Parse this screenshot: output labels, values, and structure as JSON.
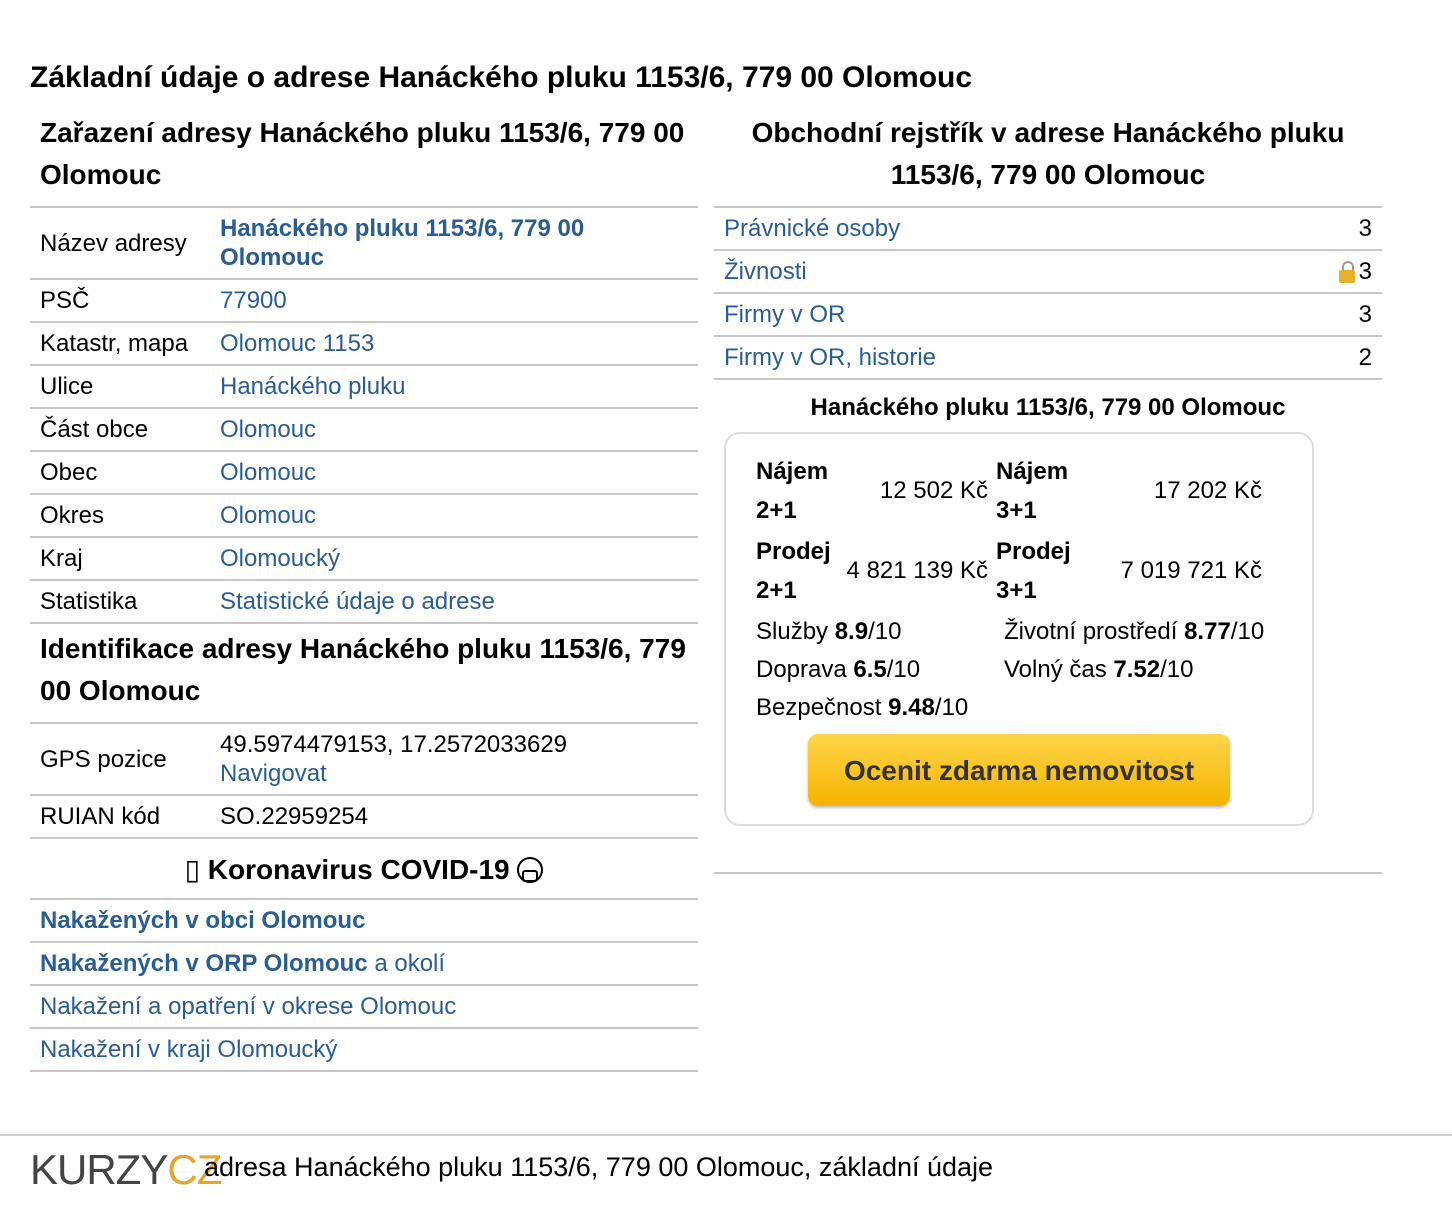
{
  "main_title": "Základní údaje o adrese Hanáckého pluku 1153/6, 779 00 Olomouc",
  "left": {
    "classification_title": "Zařazení adresy Hanáckého pluku 1153/6, 779 00 Olomouc",
    "rows": [
      {
        "key": "Název adresy",
        "value": "Hanáckého pluku 1153/6, 779 00 Olomouc"
      },
      {
        "key": "PSČ",
        "value": "77900"
      },
      {
        "key": "Katastr, mapa",
        "value": "Olomouc 1153"
      },
      {
        "key": "Ulice",
        "value": "Hanáckého pluku"
      },
      {
        "key": "Část obce",
        "value": "Olomouc"
      },
      {
        "key": "Obec",
        "value": "Olomouc"
      },
      {
        "key": "Okres",
        "value": "Olomouc"
      },
      {
        "key": "Kraj",
        "value": "Olomoucký"
      },
      {
        "key": "Statistika",
        "value": "Statistické údaje o adrese"
      }
    ],
    "identification_title": "Identifikace adresy Hanáckého pluku 1153/6, 779 00 Olomouc",
    "gps_label": "GPS pozice",
    "gps_value": "49.5974479153, 17.2572033629",
    "navigate_label": "Navigovat",
    "ruian_label": "RUIAN kód",
    "ruian_value": "SO.22959254",
    "covid_prefix": "▯",
    "covid_title": "Koronavirus COVID-19",
    "covid_links": {
      "obec": "Nakažených v obci Olomouc",
      "orp": "Nakažených v ORP Olomouc",
      "orp_suffix": " a okolí",
      "okres": "Nakažení a opatření v okrese Olomouc",
      "kraj": "Nakažení v kraji Olomoucký"
    }
  },
  "right": {
    "register_title": "Obchodní rejstřík v adrese Hanáckého pluku 1153/6, 779 00 Olomouc",
    "register_rows": [
      {
        "label": "Právnické osoby",
        "count": "3"
      },
      {
        "label": "Živnosti",
        "count": "3",
        "locked": true
      },
      {
        "label": "Firmy v OR",
        "count": "3"
      },
      {
        "label": "Firmy v OR, historie",
        "count": "2"
      }
    ],
    "address_heading": "Hanáckého pluku 1153/6, 779 00 Olomouc",
    "prices": {
      "rent21_label": "Nájem 2+1",
      "rent21_value": "12 502 Kč",
      "rent31_label": "Nájem 3+1",
      "rent31_value": "17 202 Kč",
      "sale21_label": "Prodej 2+1",
      "sale21_value": "4 821 139 Kč",
      "sale31_label": "Prodej 3+1",
      "sale31_value": "7 019 721 Kč"
    },
    "scores": {
      "services_label": "Služby ",
      "services_value": "8.9",
      "services_max": "/10",
      "environment_label": "Životní prostředí ",
      "environment_value": "8.77",
      "environment_max": "/10",
      "transport_label": "Doprava ",
      "transport_value": "6.5",
      "transport_max": "/10",
      "leisure_label": "Volný čas ",
      "leisure_value": "7.52",
      "leisure_max": "/10",
      "safety_label": "Bezpečnost ",
      "safety_value": "9.48",
      "safety_max": "/10"
    },
    "cta_label": "Ocenit zdarma nemovitost"
  },
  "footer": {
    "logo_a": "KURZY",
    "logo_b": "CZ",
    "text": "adresa Hanáckého pluku 1153/6, 779 00 Olomouc, základní údaje"
  },
  "colors": {
    "link": "#2a5d92",
    "cta": "#f4b400",
    "logo_accent": "#e3a72f"
  }
}
